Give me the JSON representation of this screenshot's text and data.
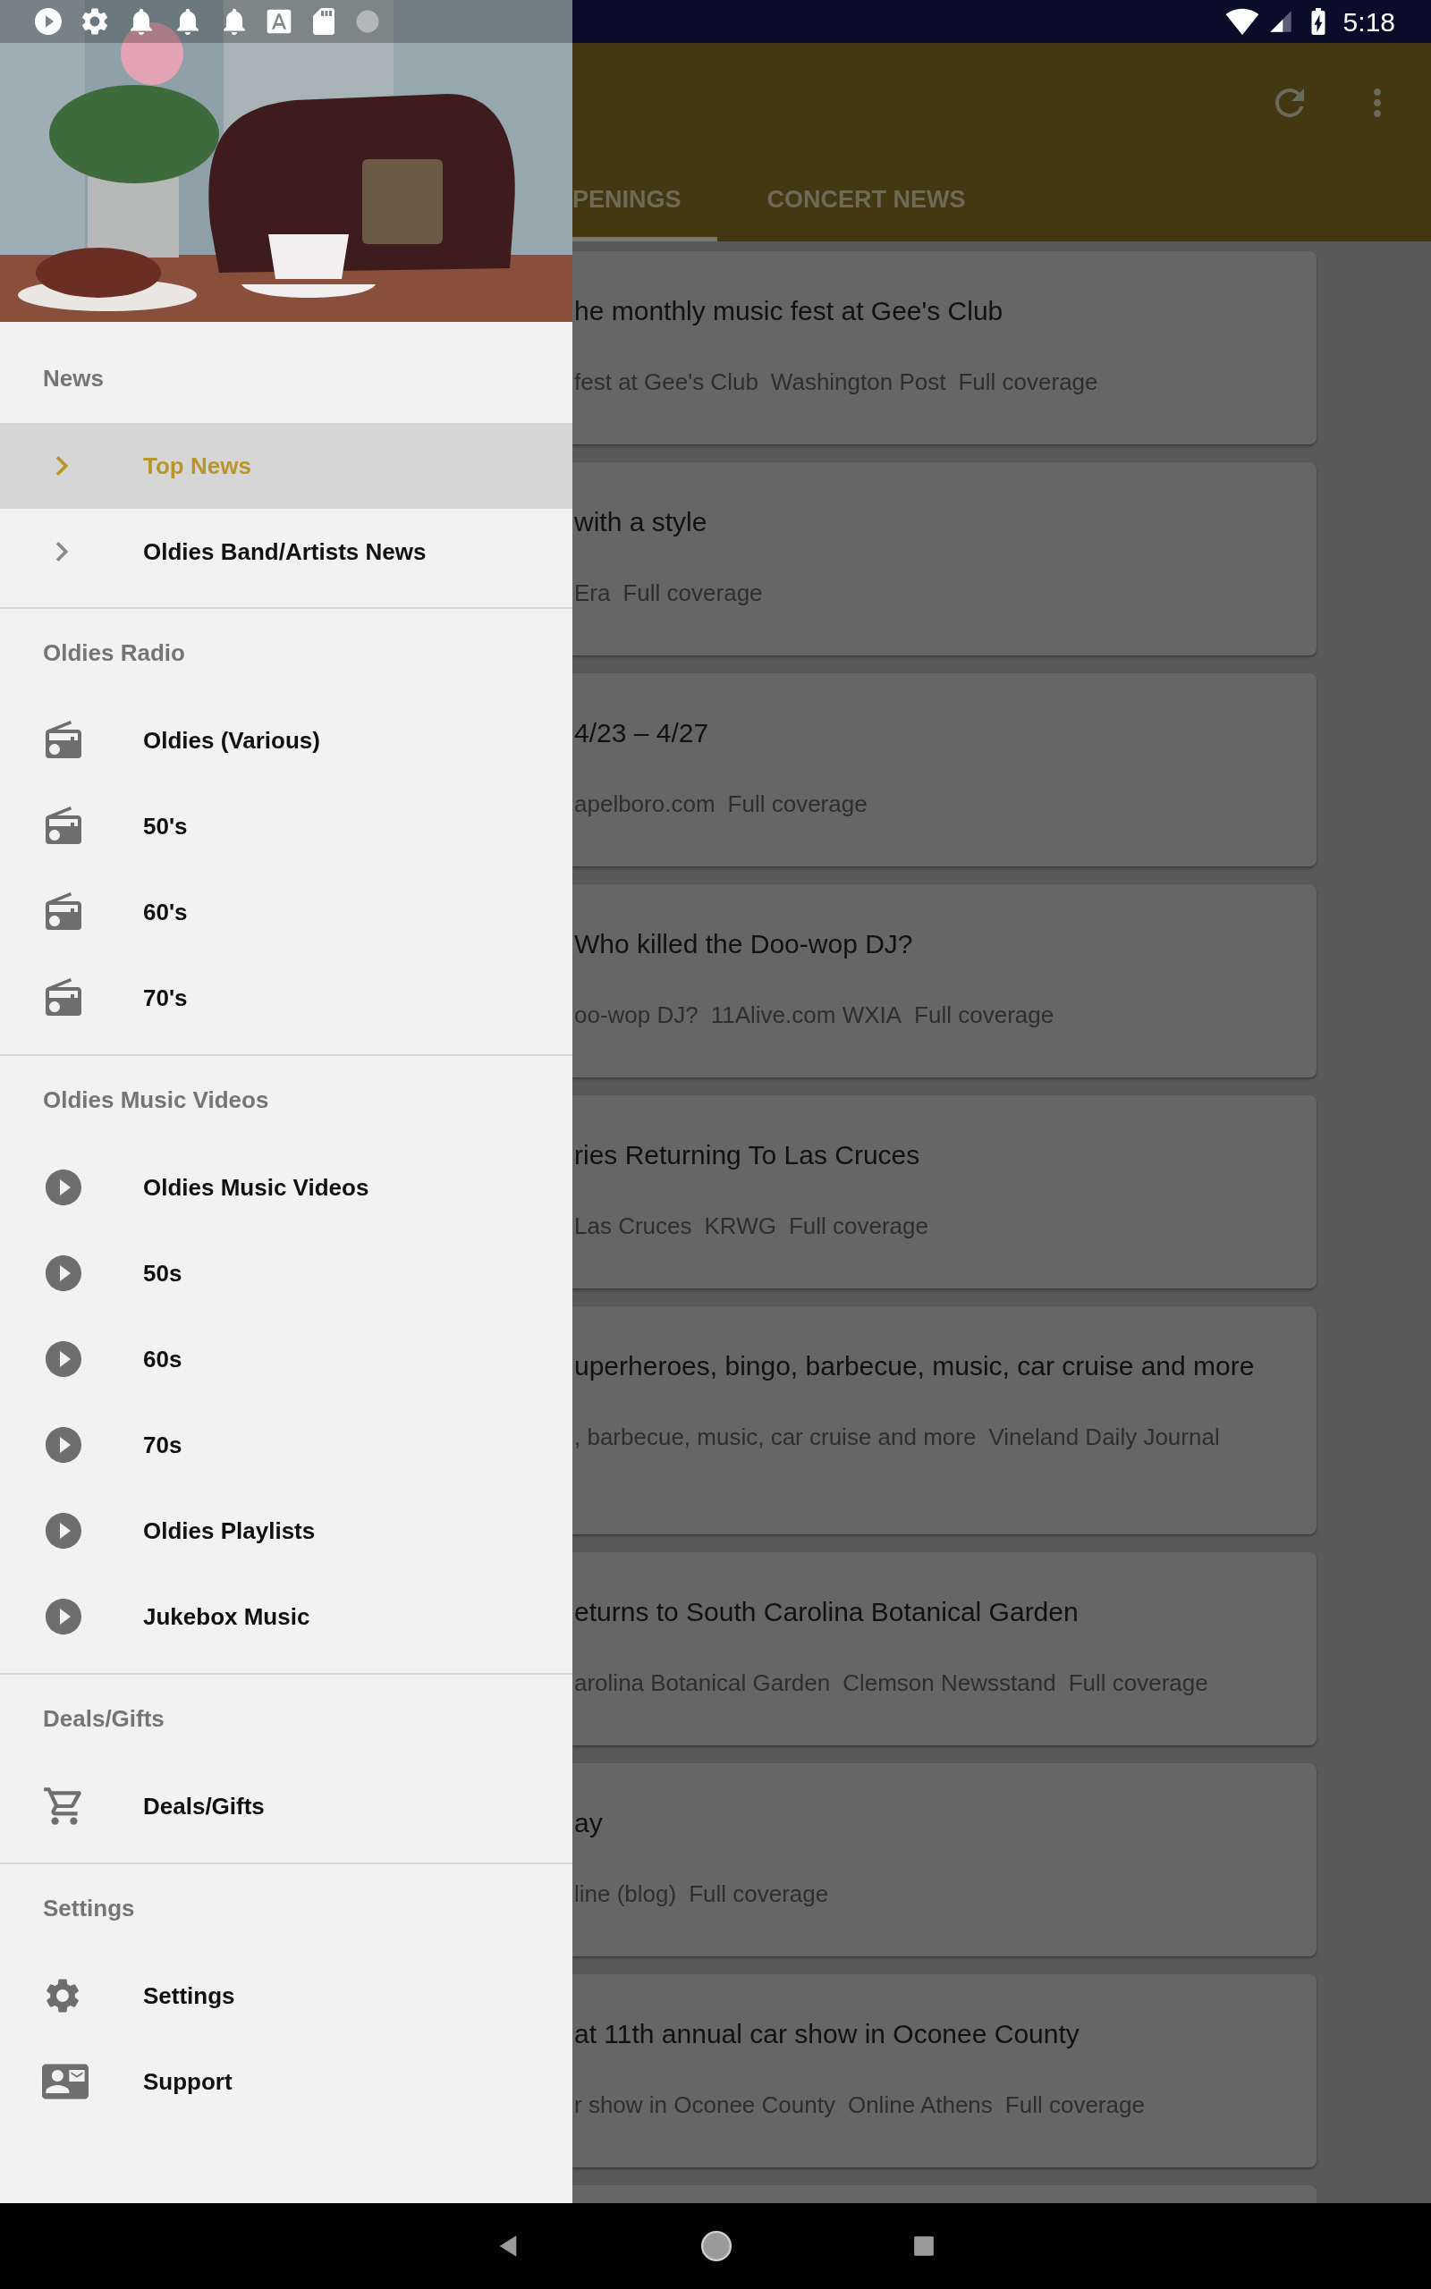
{
  "status_bar": {
    "time": "5:18"
  },
  "toolbar": {
    "tabs": [
      {
        "label": "PENINGS",
        "selected": true
      },
      {
        "label": "CONCERT NEWS",
        "selected": false
      }
    ]
  },
  "drawer": {
    "sections": [
      {
        "title": "News",
        "items": [
          {
            "label": "Top News",
            "kind": "news",
            "selected": true
          },
          {
            "label": "Oldies Band/Artists News",
            "kind": "news",
            "selected": false
          }
        ]
      },
      {
        "title": "Oldies Radio",
        "items": [
          {
            "label": "Oldies (Various)",
            "kind": "radio",
            "selected": false
          },
          {
            "label": "50's",
            "kind": "radio",
            "selected": false
          },
          {
            "label": "60's",
            "kind": "radio",
            "selected": false
          },
          {
            "label": "70's",
            "kind": "radio",
            "selected": false
          }
        ]
      },
      {
        "title": "Oldies Music Videos",
        "items": [
          {
            "label": "Oldies Music Videos",
            "kind": "video",
            "selected": false
          },
          {
            "label": "50s",
            "kind": "video",
            "selected": false
          },
          {
            "label": "60s",
            "kind": "video",
            "selected": false
          },
          {
            "label": "70s",
            "kind": "video",
            "selected": false
          },
          {
            "label": "Oldies Playlists",
            "kind": "video",
            "selected": false
          },
          {
            "label": "Jukebox Music",
            "kind": "video",
            "selected": false
          }
        ]
      },
      {
        "title": "Deals/Gifts",
        "items": [
          {
            "label": "Deals/Gifts",
            "kind": "cart",
            "selected": false
          }
        ]
      },
      {
        "title": "Settings",
        "items": [
          {
            "label": "Settings",
            "kind": "settings",
            "selected": false
          },
          {
            "label": "Support",
            "kind": "support",
            "selected": false
          }
        ]
      }
    ]
  },
  "news_cards": [
    {
      "title": "he monthly music fest at Gee's Club",
      "sources": [
        "fest at Gee's Club",
        "Washington Post",
        "Full coverage"
      ]
    },
    {
      "title": "with a style",
      "sources": [
        "Era",
        "Full coverage"
      ]
    },
    {
      "title": "4/23 – 4/27",
      "sources": [
        "apelboro.com",
        "Full coverage"
      ]
    },
    {
      "title": "Who killed the Doo-wop DJ?",
      "sources": [
        "oo-wop DJ?",
        "11Alive.com WXIA",
        "Full coverage"
      ]
    },
    {
      "title": "ries Returning To Las Cruces",
      "sources": [
        "Las Cruces",
        "KRWG",
        "Full coverage"
      ]
    },
    {
      "title": "uperheroes, bingo, barbecue, music, car cruise and more",
      "sources": [
        ", barbecue, music, car cruise and more",
        "Vineland Daily Journal"
      ]
    },
    {
      "title": "eturns to South Carolina Botanical Garden",
      "sources": [
        "arolina Botanical Garden",
        "Clemson Newsstand",
        "Full coverage"
      ]
    },
    {
      "title": "ay",
      "sources": [
        "line (blog)",
        "Full coverage"
      ]
    },
    {
      "title": "at 11th annual car show in Oconee County",
      "sources": [
        "r show in Oconee County",
        "Online Athens",
        "Full coverage"
      ]
    }
  ]
}
